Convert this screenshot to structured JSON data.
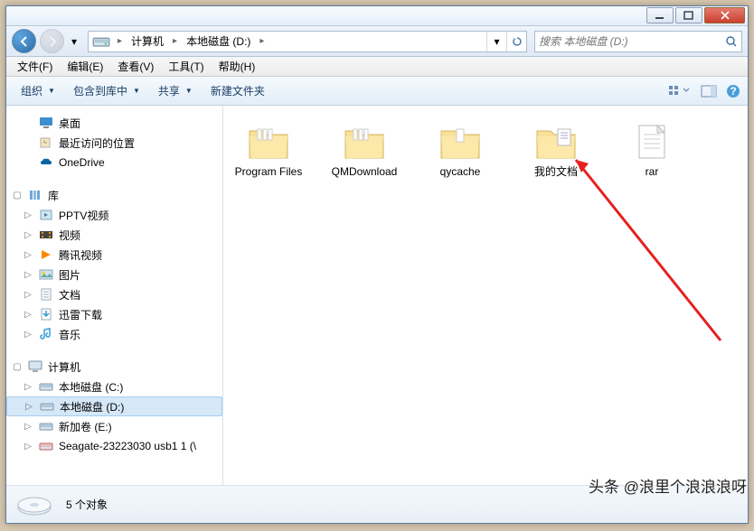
{
  "titlebar": {
    "buttons": [
      "minimize",
      "maximize",
      "close"
    ]
  },
  "nav": {
    "breadcrumbs": [
      "计算机",
      "本地磁盘 (D:)"
    ],
    "search_placeholder": "搜索 本地磁盘 (D:)"
  },
  "menubar": {
    "file": "文件(F)",
    "edit": "编辑(E)",
    "view": "查看(V)",
    "tools": "工具(T)",
    "help": "帮助(H)"
  },
  "toolbar": {
    "organize": "组织",
    "include": "包含到库中",
    "share": "共享",
    "newfolder": "新建文件夹"
  },
  "sidebar": {
    "group1": [
      "桌面",
      "最近访问的位置",
      "OneDrive"
    ],
    "libs_header": "库",
    "libs": [
      "PPTV视频",
      "视频",
      "腾讯视频",
      "图片",
      "文档",
      "迅雷下载",
      "音乐"
    ],
    "computer_header": "计算机",
    "drives": [
      "本地磁盘 (C:)",
      "本地磁盘 (D:)",
      "新加卷 (E:)",
      "Seagate-23223030 usb1 1 (\\"
    ]
  },
  "files": [
    {
      "name": "Program Files",
      "type": "folder"
    },
    {
      "name": "QMDownload",
      "type": "folder"
    },
    {
      "name": "qycache",
      "type": "folder"
    },
    {
      "name": "我的文档",
      "type": "folder-doc"
    },
    {
      "name": "rar",
      "type": "text"
    }
  ],
  "status": {
    "count": "5 个对象"
  },
  "watermark": "头条 @浪里个浪浪浪呀"
}
